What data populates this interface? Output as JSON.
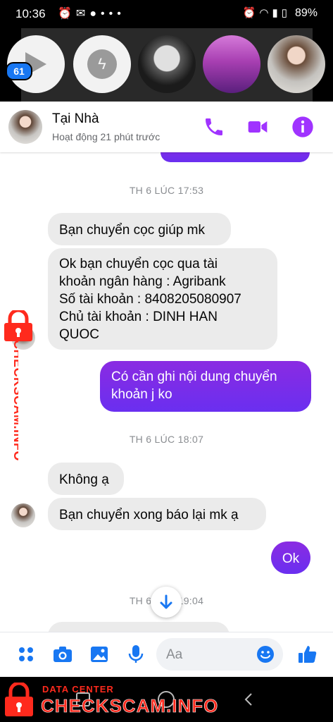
{
  "status_bar": {
    "time": "10:36",
    "battery": "89%"
  },
  "chat_heads": {
    "badge": "61"
  },
  "header": {
    "name": "Tại Nhà",
    "status": "Hoạt động 21 phút trước"
  },
  "messages": {
    "ts1": "TH 6 LÚC 17:53",
    "in1": "Bạn chuyển cọc giúp mk",
    "in2_l1": "Ok bạn chuyển cọc qua tài",
    "in2_l2": "khoản ngân hàng : Agribank",
    "in2_l3": "Số tài khoản : 8408205080907",
    "in2_l4": "Chủ tài khoản : DINH HAN",
    "in2_l5": "QUOC",
    "out1_l1": "Có cần ghi nội dung chuyển",
    "out1_l2": "khoản j ko",
    "ts2": "TH 6 LÚC 18:07",
    "in3": "Không ạ",
    "in4": "Bạn chuyển xong báo lại mk ạ",
    "out2": "Ok",
    "ts3": "TH 6 LÚC 19:04"
  },
  "composer": {
    "placeholder": "Aa"
  },
  "watermark": {
    "top": "DATA CENTER",
    "main": "CHECKSCAM.INFO"
  },
  "colors": {
    "accent": "#a033ff",
    "sent_bubble": "#7b1fe6",
    "received_bubble": "#ebebeb",
    "watermark": "#ff2a1d"
  },
  "icons": [
    "alarm-icon",
    "messages-icon",
    "chat-icon",
    "more-icon",
    "wifi-icon",
    "signal-icon",
    "battery-icon",
    "play-icon",
    "messenger-icon",
    "phone-icon",
    "video-icon",
    "info-icon",
    "scroll-down-icon",
    "apps-icon",
    "camera-icon",
    "gallery-icon",
    "mic-icon",
    "emoji-icon",
    "like-icon",
    "lock-icon",
    "home-icon",
    "back-icon",
    "recent-icon"
  ]
}
